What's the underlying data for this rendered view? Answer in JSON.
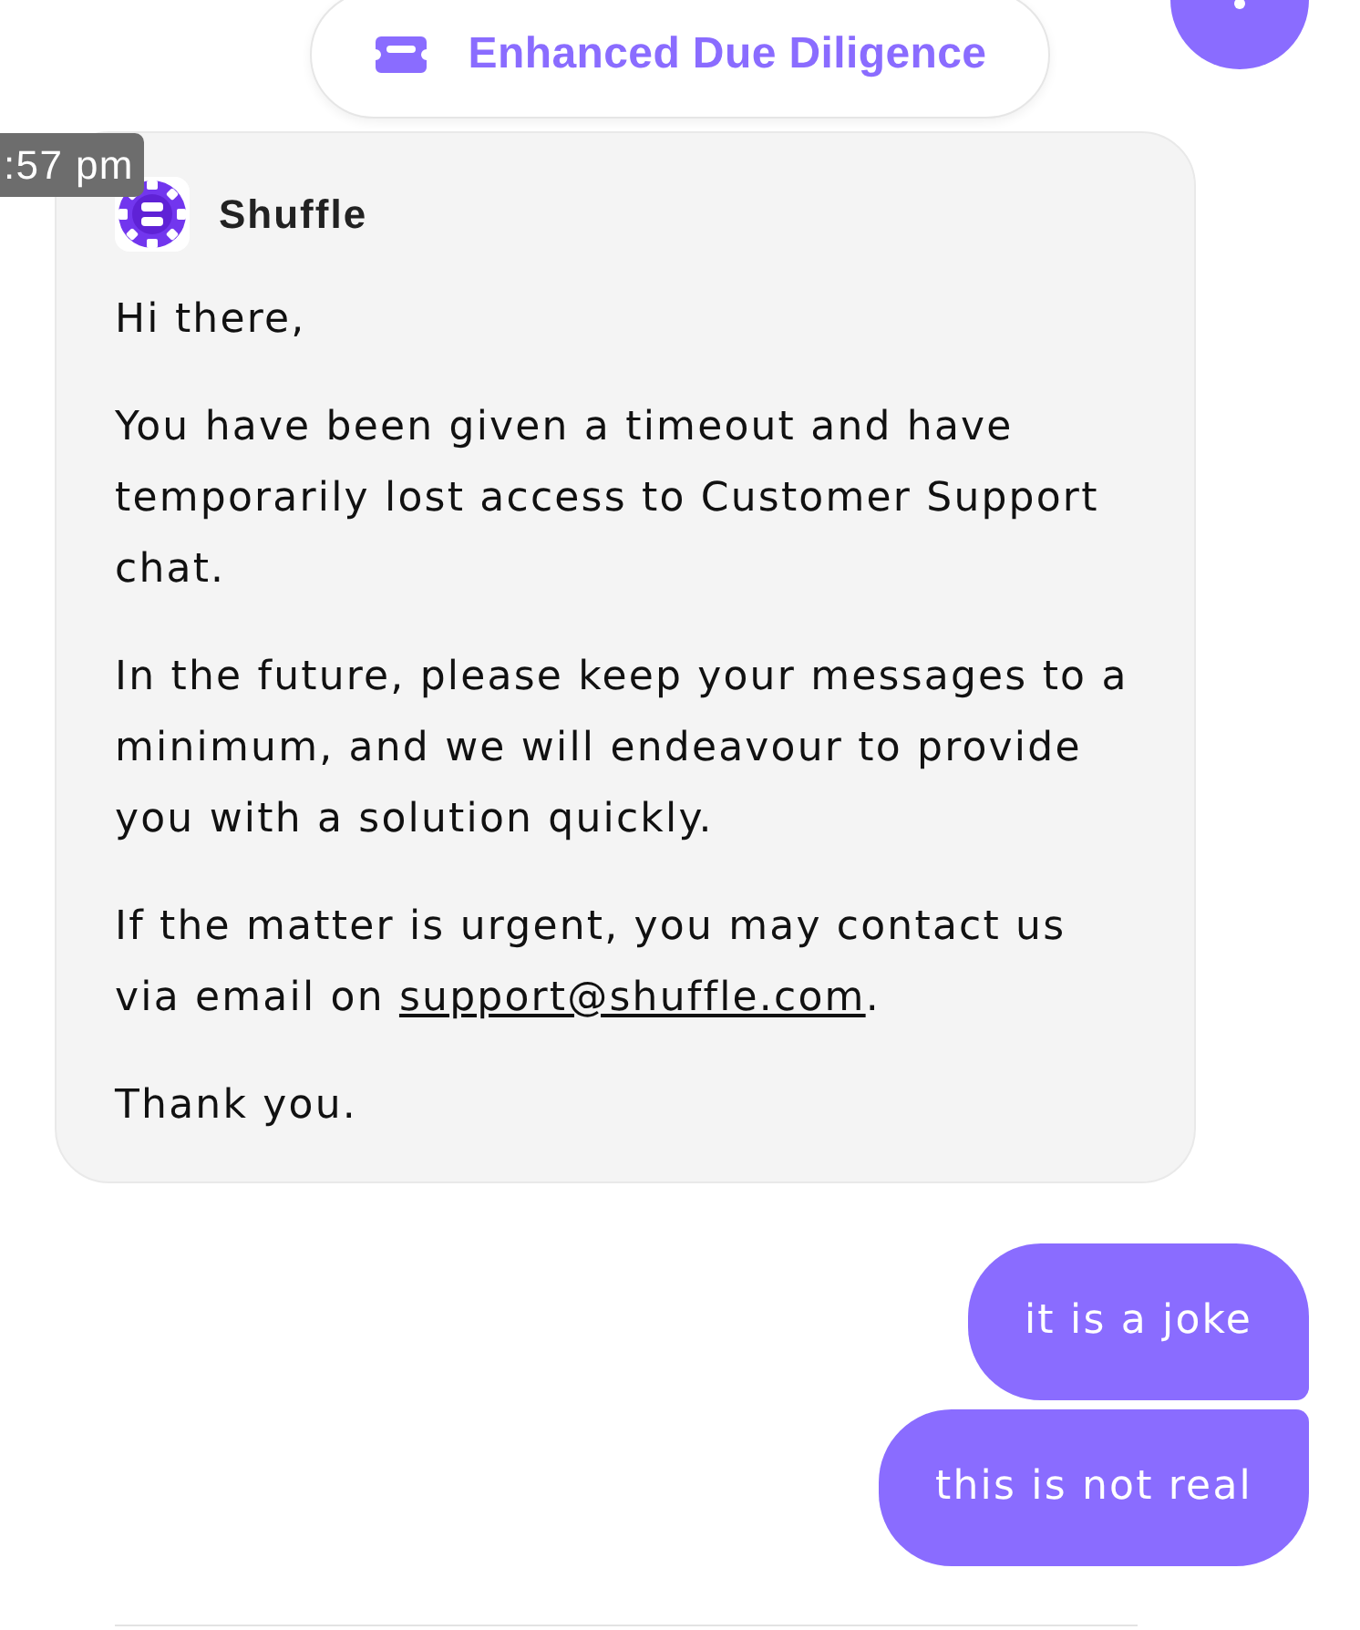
{
  "topic": {
    "label": "Enhanced Due Diligence"
  },
  "messages": [
    {
      "kind": "incoming",
      "timestamp": ":57 pm",
      "sender": "Shuffle",
      "paragraphs": [
        [
          {
            "kind": "text",
            "text": "Hi there,"
          }
        ],
        [
          {
            "kind": "text",
            "text": "You have been given a timeout and have temporarily lost access to Customer Support chat."
          }
        ],
        [
          {
            "kind": "text",
            "text": "In the future, please keep your messages to a minimum, and we will endeavour to provide you with a solution quickly."
          }
        ],
        [
          {
            "kind": "text",
            "text": "If the matter is urgent, you may contact us via email on "
          },
          {
            "kind": "link",
            "text": "support@shuffle.com"
          },
          {
            "kind": "text",
            "text": "."
          }
        ],
        [
          {
            "kind": "text",
            "text": "Thank you."
          }
        ]
      ]
    },
    {
      "kind": "outgoing",
      "text": "it is a joke"
    },
    {
      "kind": "outgoing",
      "text": "this is not real"
    }
  ]
}
